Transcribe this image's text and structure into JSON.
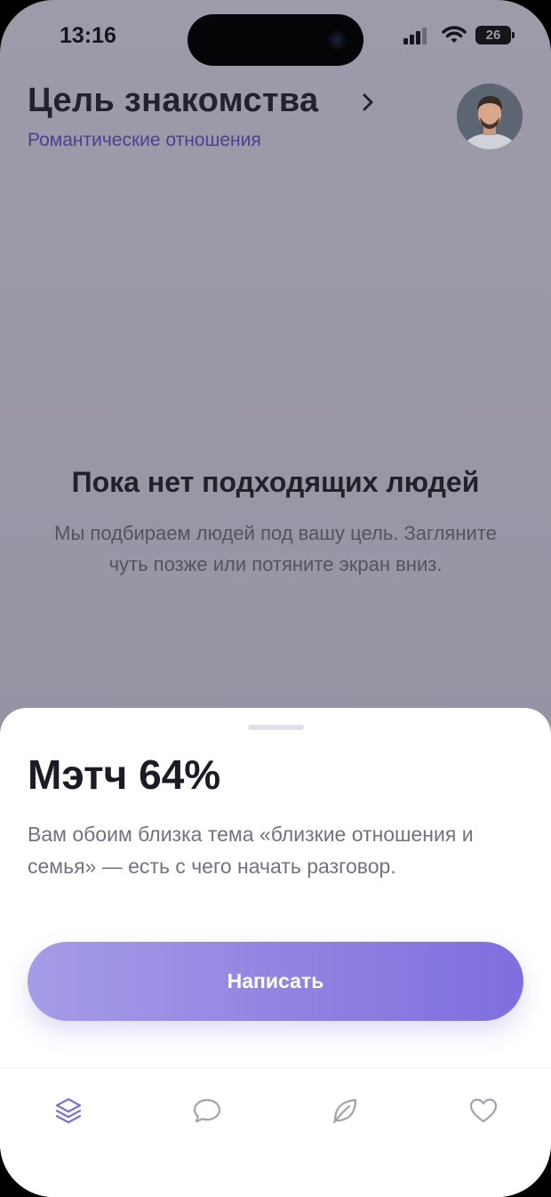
{
  "status_bar": {
    "time": "13:16",
    "battery": "26"
  },
  "header": {
    "title": "Цель знакомства",
    "chevron_icon": "chevron-right-icon",
    "subtitle": "Романтические отношения",
    "avatar_icon": "profile-avatar"
  },
  "empty_state": {
    "title": "Пока нет подходящих людей",
    "text": "Мы подбираем людей под вашу цель. Загляните чуть позже или потяните экран вниз."
  },
  "sheet": {
    "match_title": "Мэтч 64%",
    "match_text": "Вам обоим близка тема «близкие отношения и семья» — есть с чего начать разговор.",
    "cta_label": "Написать"
  },
  "tabbar": {
    "items": [
      {
        "icon": "layers-icon",
        "active": true
      },
      {
        "icon": "chat-bubble-icon",
        "active": false
      },
      {
        "icon": "leaf-icon",
        "active": false
      },
      {
        "icon": "heart-icon",
        "active": false
      }
    ]
  },
  "colors": {
    "accent": "#8e80e0",
    "subtitle": "#4d3f93",
    "overlay": "#9895a5",
    "icon_active": "#7b6fd6",
    "icon_inactive": "#a4a1ad"
  }
}
